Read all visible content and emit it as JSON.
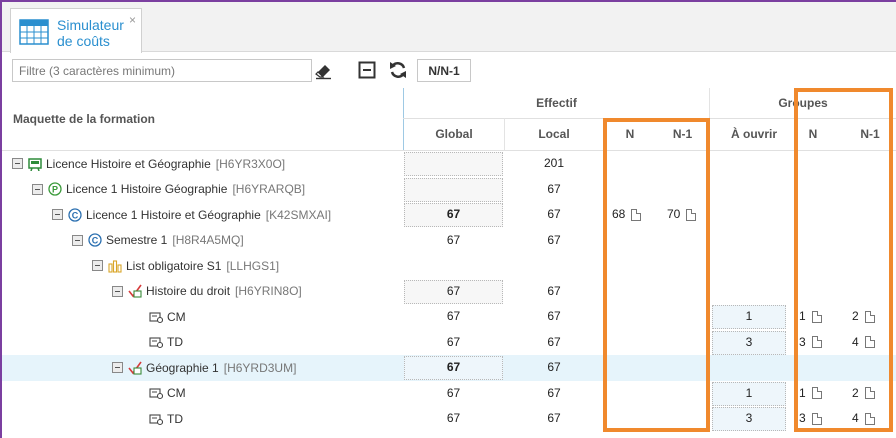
{
  "tab": {
    "label": "Simulateur de coûts",
    "close": "×"
  },
  "toolbar": {
    "filter_placeholder": "Filtre (3 caractères minimum)",
    "toggle_label": "N/N-1"
  },
  "headers": {
    "maquette": "Maquette de la formation",
    "effectif": "Effectif",
    "groupes": "Groupes",
    "global": "Global",
    "local": "Local",
    "n": "N",
    "n1": "N-1",
    "a_ouvrir": "À ouvrir",
    "gn": "N",
    "gn1": "N-1"
  },
  "rows": [
    {
      "label": "Licence Histoire et Géographie",
      "code": "[H6YR3X0O]",
      "icon": "diploma-icon",
      "global": "",
      "local": "201"
    },
    {
      "label": "Licence 1 Histoire Géographie",
      "code": "[H6YRARQB]",
      "icon": "parcours-p-icon",
      "global": "",
      "local": "67"
    },
    {
      "label": "Licence 1 Histoire et Géographie",
      "code": "[K42SMXAI]",
      "icon": "course-c-icon",
      "global": "67",
      "local": "67",
      "n": "68",
      "n1": "70"
    },
    {
      "label": "Semestre 1",
      "code": "[H8R4A5MQ]",
      "icon": "course-c-icon",
      "global": "67",
      "local": "67"
    },
    {
      "label": "List obligatoire S1",
      "code": "[LLHGS1]",
      "icon": "list-icon",
      "global": "",
      "local": ""
    },
    {
      "label": "Histoire du droit",
      "code": "[H6YRIN8O]",
      "icon": "module-icon",
      "global": "67",
      "local": "67"
    },
    {
      "label": "CM",
      "code": "",
      "icon": "lesson-icon",
      "global": "67",
      "local": "67",
      "ouvrir": "1",
      "gn": "1",
      "gn1": "2"
    },
    {
      "label": "TD",
      "code": "",
      "icon": "lesson-icon",
      "global": "67",
      "local": "67",
      "ouvrir": "3",
      "gn": "3",
      "gn1": "4"
    },
    {
      "label": "Géographie 1",
      "code": "[H6YRD3UM]",
      "icon": "module-icon",
      "global": "67",
      "local": "67"
    },
    {
      "label": "CM",
      "code": "",
      "icon": "lesson-icon",
      "global": "67",
      "local": "67",
      "ouvrir": "1",
      "gn": "1",
      "gn1": "2"
    },
    {
      "label": "TD",
      "code": "",
      "icon": "lesson-icon",
      "global": "67",
      "local": "67",
      "ouvrir": "3",
      "gn": "3",
      "gn1": "4"
    }
  ],
  "colors": {
    "accent": "#2a8fcf",
    "highlight": "#f0892d",
    "frame": "#7b3fa0",
    "selected_row": "#e6f4fb"
  }
}
